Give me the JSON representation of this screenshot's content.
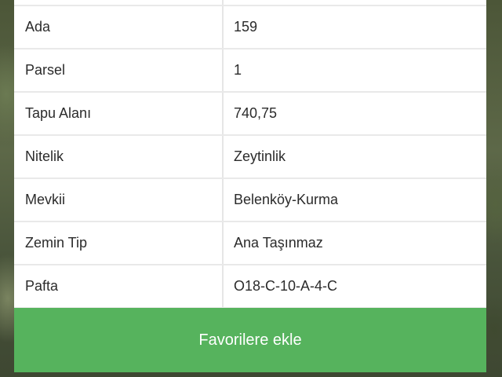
{
  "rows": [
    {
      "label": "",
      "value": ""
    },
    {
      "label": "Ada",
      "value": "159"
    },
    {
      "label": "Parsel",
      "value": "1"
    },
    {
      "label": "Tapu Alanı",
      "value": "740,75"
    },
    {
      "label": "Nitelik",
      "value": "Zeytinlik"
    },
    {
      "label": "Mevkii",
      "value": "Belenköy-Kurma"
    },
    {
      "label": "Zemin Tip",
      "value": "Ana Taşınmaz"
    },
    {
      "label": "Pafta",
      "value": "O18-C-10-A-4-C"
    }
  ],
  "favorite_button": {
    "label": "Favorilere ekle"
  },
  "colors": {
    "button": "#56b35d",
    "row_bg": "#ffffff",
    "divider": "#e6e6e6"
  }
}
